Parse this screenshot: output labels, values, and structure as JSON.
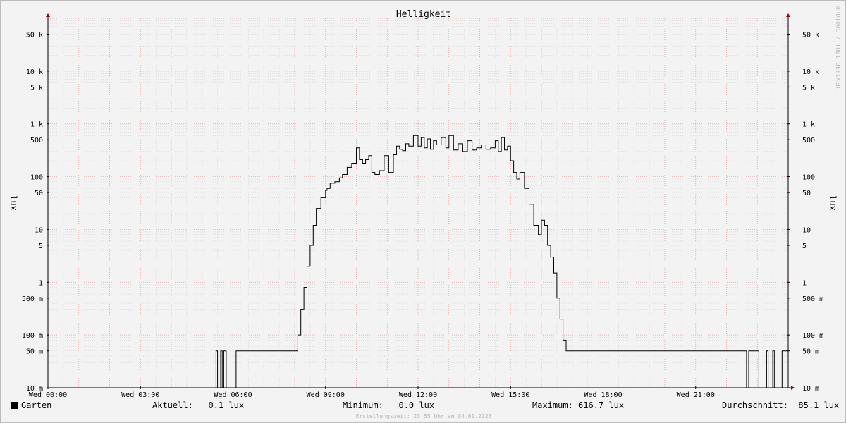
{
  "chart_data": {
    "type": "line",
    "title": "Helligkeit",
    "ylabel": "lux",
    "yscale": "log",
    "ylim": [
      0.01,
      100000
    ],
    "xlim": [
      0,
      24
    ],
    "x_tick_labels": [
      "Wed 00:00",
      "Wed 03:00",
      "Wed 06:00",
      "Wed 09:00",
      "Wed 12:00",
      "Wed 15:00",
      "Wed 18:00",
      "Wed 21:00"
    ],
    "x_tick_values": [
      0,
      3,
      6,
      9,
      12,
      15,
      18,
      21
    ],
    "y_tick_labels": [
      "10 m",
      "50 m",
      "100 m",
      "500 m",
      "1",
      "5",
      "10",
      "50",
      "100",
      "500",
      "1 k",
      "5 k",
      "10 k",
      "50 k"
    ],
    "y_tick_values": [
      0.01,
      0.05,
      0.1,
      0.5,
      1,
      5,
      10,
      50,
      100,
      500,
      1000,
      5000,
      10000,
      50000
    ],
    "grid": true,
    "series": [
      {
        "name": "Garten",
        "color": "#000000",
        "x": [
          0,
          5.45,
          5.5,
          5.6,
          5.65,
          5.7,
          5.78,
          5.85,
          6.1,
          6.15,
          7.9,
          8.1,
          8.2,
          8.3,
          8.4,
          8.5,
          8.6,
          8.7,
          8.85,
          9.0,
          9.05,
          9.15,
          9.3,
          9.45,
          9.55,
          9.7,
          9.85,
          10.0,
          10.1,
          10.2,
          10.3,
          10.4,
          10.5,
          10.6,
          10.75,
          10.9,
          11.05,
          11.2,
          11.3,
          11.4,
          11.5,
          11.6,
          11.7,
          11.85,
          12.0,
          12.1,
          12.2,
          12.3,
          12.4,
          12.5,
          12.6,
          12.75,
          12.9,
          13.0,
          13.15,
          13.3,
          13.45,
          13.6,
          13.75,
          13.9,
          14.05,
          14.2,
          14.35,
          14.5,
          14.6,
          14.7,
          14.8,
          14.9,
          15.0,
          15.1,
          15.2,
          15.3,
          15.45,
          15.6,
          15.75,
          15.9,
          16.0,
          16.1,
          16.2,
          16.3,
          16.4,
          16.5,
          16.6,
          16.7,
          16.8,
          16.9,
          17.0,
          17.1,
          17.2,
          17.3,
          17.4,
          17.5,
          17.6,
          17.8,
          22.6,
          22.65,
          22.72,
          23.0,
          23.05,
          23.3,
          23.35,
          23.5,
          23.55,
          23.8,
          23.85,
          24.0
        ],
        "values": [
          0.01,
          0.05,
          0.01,
          0.05,
          0.01,
          0.05,
          0.01,
          0.01,
          0.05,
          0.05,
          0.05,
          0.1,
          0.3,
          0.8,
          2,
          5,
          12,
          25,
          40,
          55,
          60,
          75,
          80,
          95,
          110,
          150,
          180,
          350,
          210,
          180,
          210,
          250,
          120,
          110,
          130,
          250,
          120,
          260,
          380,
          330,
          310,
          420,
          380,
          600,
          380,
          550,
          350,
          520,
          330,
          480,
          400,
          550,
          350,
          600,
          320,
          420,
          300,
          480,
          320,
          350,
          400,
          330,
          350,
          480,
          300,
          550,
          320,
          380,
          200,
          120,
          90,
          120,
          60,
          30,
          12,
          8,
          15,
          12,
          5,
          3,
          1.5,
          0.5,
          0.2,
          0.08,
          0.05,
          0.05,
          0.05,
          0.05,
          0.05,
          0.05,
          0.05,
          0.05,
          0.05,
          0.05,
          0.05,
          0.01,
          0.05,
          0.05,
          0.01,
          0.05,
          0.01,
          0.05,
          0.01,
          0.05,
          0.05,
          0.05
        ]
      }
    ]
  },
  "legend": {
    "series_name": "Garten",
    "current_label": "Aktuell:",
    "current_value": "0.1 lux",
    "min_label": "Minimum:",
    "min_value": "0.0 lux",
    "max_label": "Maximum:",
    "max_value": "616.7 lux",
    "avg_label": "Durchschnitt:",
    "avg_value": "85.1 lux"
  },
  "watermark": "RRDTOOL / TOBI OETIKER",
  "footer": "Erstellungszeit: 23:55 Uhr am 04.01.2023"
}
